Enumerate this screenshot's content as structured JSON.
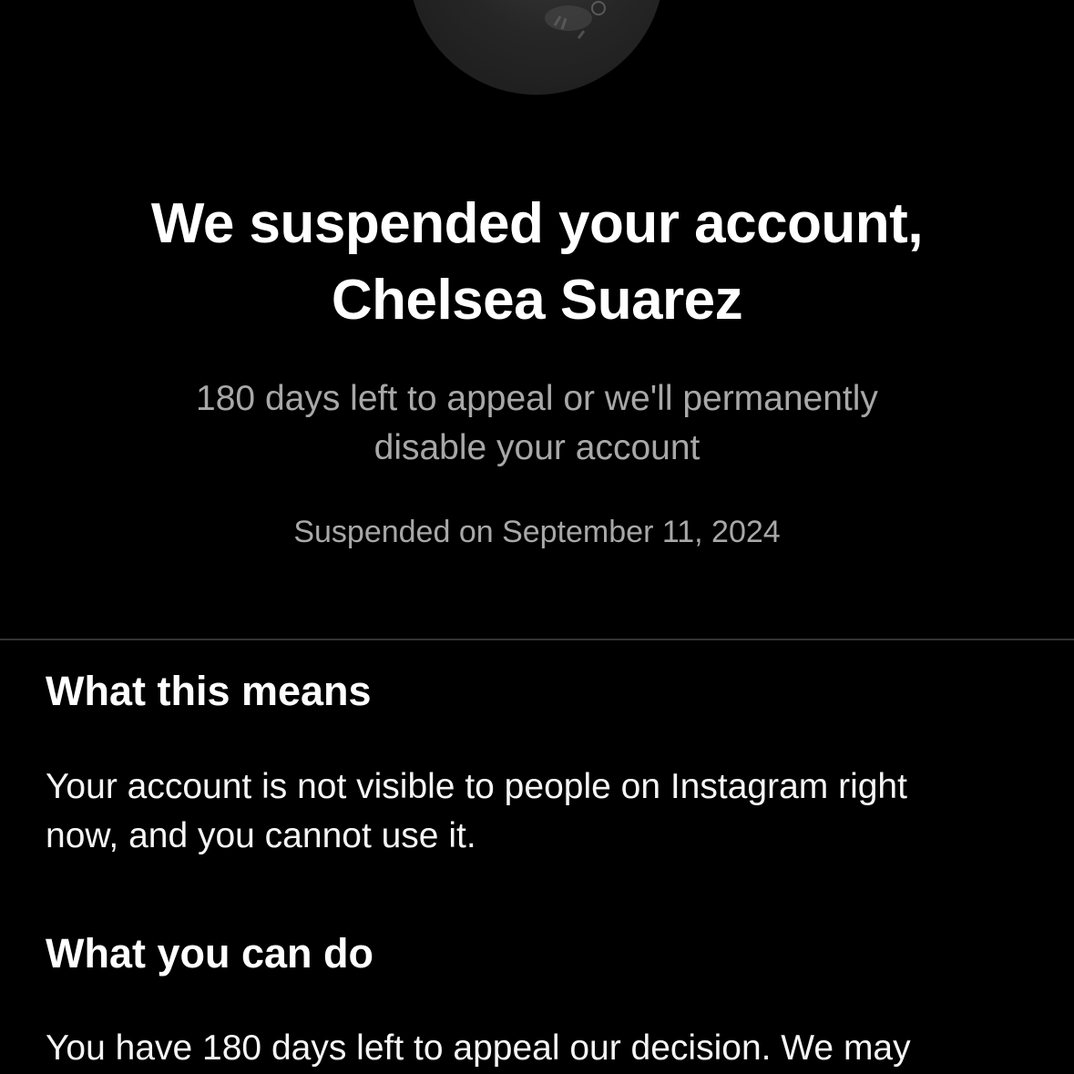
{
  "header": {
    "title_line1": "We suspended your account,",
    "title_line2": "Chelsea Suarez",
    "subtitle_line1": "180 days left to appeal or we'll permanently",
    "subtitle_line2": "disable your account",
    "suspended_date": "Suspended on September 11, 2024"
  },
  "avatar": {
    "icon": "profile-photo-avatar"
  },
  "sections": [
    {
      "heading": "What this means",
      "body_lines": [
        "Your account is not visible to people on Instagram right",
        "now, and you cannot use it."
      ]
    },
    {
      "heading": "What you can do",
      "body_lines": [
        "You have 180 days left to appeal our decision. We may"
      ]
    }
  ],
  "colors": {
    "background": "#000000",
    "text_primary": "#ffffff",
    "text_secondary": "#a8a8a8",
    "divider": "#333333"
  }
}
